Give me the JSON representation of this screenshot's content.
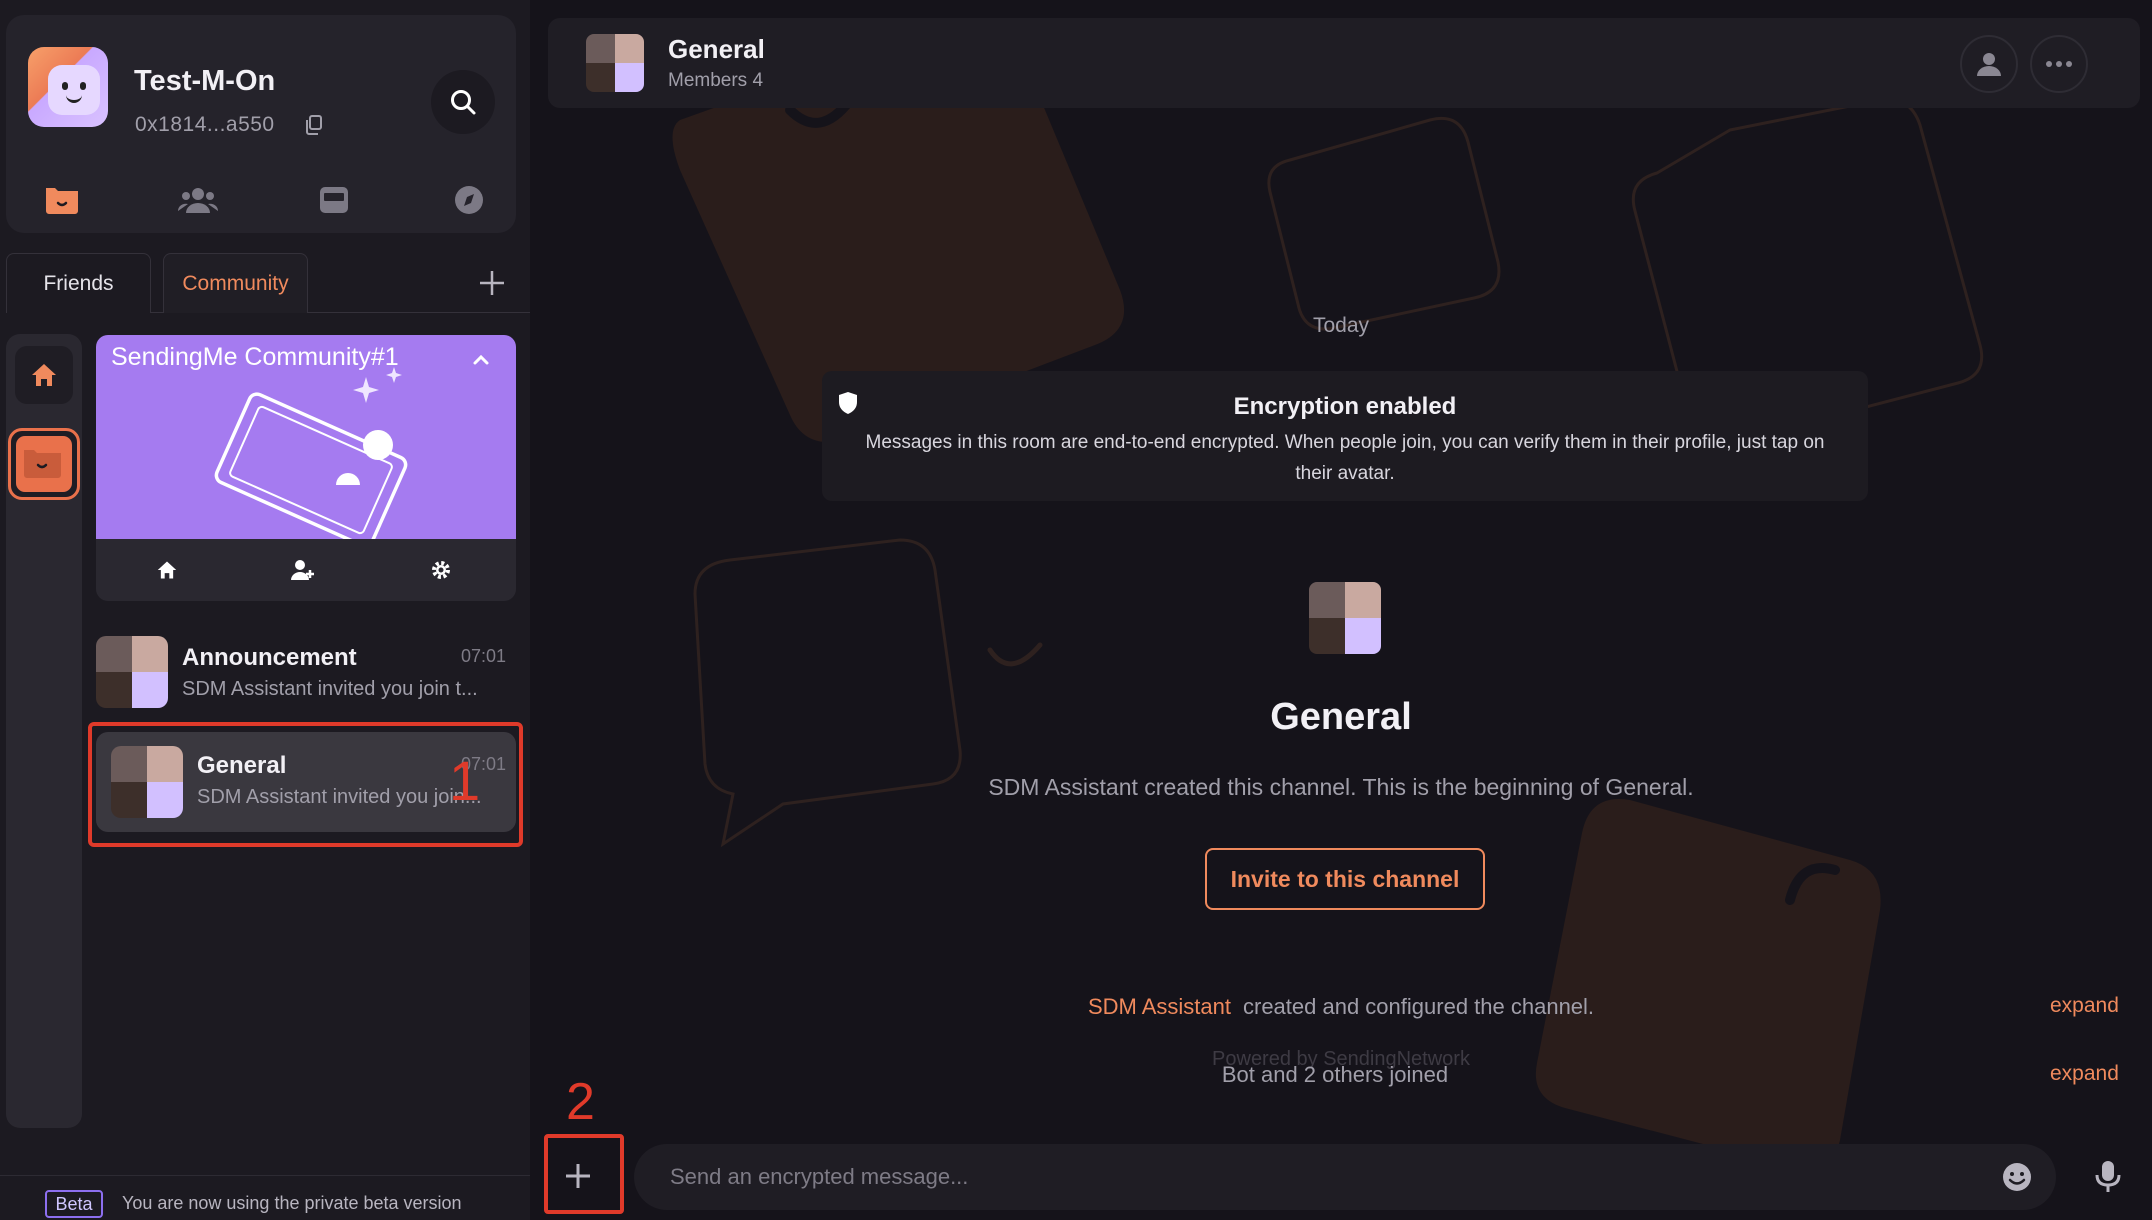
{
  "profile": {
    "username": "Test-M-On",
    "address": "0x1814...a550"
  },
  "tabs": [
    {
      "label": "Friends",
      "active": false
    },
    {
      "label": "Community",
      "active": true
    }
  ],
  "community": {
    "title": "SendingMe Community#1"
  },
  "rooms": [
    {
      "name": "Announcement",
      "time": "07:01",
      "last_message": "SDM Assistant invited you join t..."
    },
    {
      "name": "General",
      "time": "07:01",
      "last_message": "SDM Assistant invited you join..."
    }
  ],
  "annotations": {
    "one": "1",
    "two": "2"
  },
  "beta": {
    "badge": "Beta",
    "text": "You are now using the private beta version"
  },
  "header": {
    "title": "General",
    "members": "Members 4"
  },
  "timeline": {
    "date_divider": "Today",
    "encryption_title": "Encryption enabled",
    "encryption_body": "Messages in this room are end-to-end encrypted. When people join, you can verify them in their profile, just tap on their avatar.",
    "channel_title": "General",
    "channel_desc": "SDM Assistant created this channel. This is the beginning of General.",
    "invite_label": "Invite to this channel",
    "event1_who": "SDM Assistant",
    "event1_text": "created and configured the channel.",
    "event2_text": "Bot and 2 others joined",
    "expand_label": "expand",
    "powered_by": "Powered by SendingNetwork"
  },
  "composer": {
    "placeholder": "Send an encrypted message..."
  },
  "colors": {
    "accent": "#f08a5d",
    "highlight": "#e03a2a",
    "community_banner": "#a57bf0"
  },
  "icons": [
    "search-icon",
    "copy-icon",
    "chat-icon",
    "people-icon",
    "inbox-icon",
    "compass-icon",
    "plus-icon",
    "home-icon",
    "chevron-up-icon",
    "add-member-icon",
    "gear-icon",
    "user-icon",
    "more-icon",
    "shield-icon",
    "emoji-icon",
    "mic-icon"
  ]
}
